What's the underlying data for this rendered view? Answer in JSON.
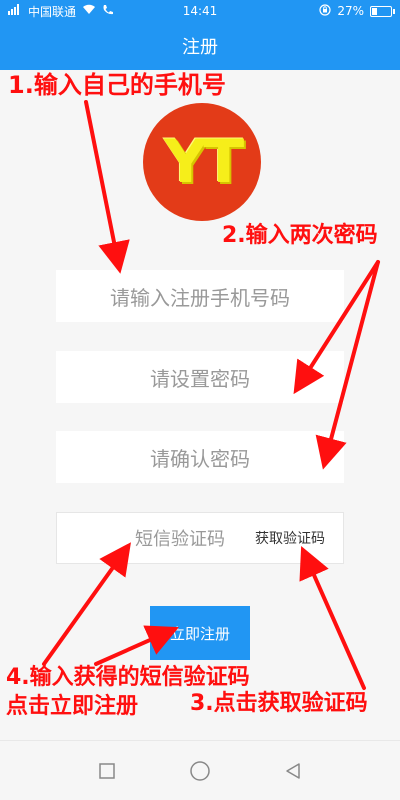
{
  "status_bar": {
    "carrier": "中国联通",
    "time": "14:41",
    "battery_percent": "27%",
    "battery_level": 0.27,
    "icons": [
      "signal-icon",
      "wifi-icon",
      "call-icon",
      "rotation-lock-icon",
      "battery-icon"
    ]
  },
  "app_bar": {
    "title": "注册"
  },
  "logo": {
    "text": "YT",
    "background": "#e33b18",
    "text_color": "#f6ee1a"
  },
  "form": {
    "phone_placeholder": "请输入注册手机号码",
    "password_placeholder": "请设置密码",
    "confirm_placeholder": "请确认密码",
    "sms_placeholder": "短信验证码",
    "get_code_label": "获取验证码",
    "submit_label": "立即注册"
  },
  "annotations": {
    "step1": "1.输入自己的手机号",
    "step2": "2.输入两次密码",
    "step3": "3.点击获取验证码",
    "step4_line1": "4.输入获得的短信验证码",
    "step4_line2": "点击立即注册"
  },
  "colors": {
    "primary": "#2196f3",
    "annotation": "#ff0f0f"
  },
  "nav_bar": {
    "icons": [
      "recents-icon",
      "home-icon",
      "back-icon"
    ]
  }
}
